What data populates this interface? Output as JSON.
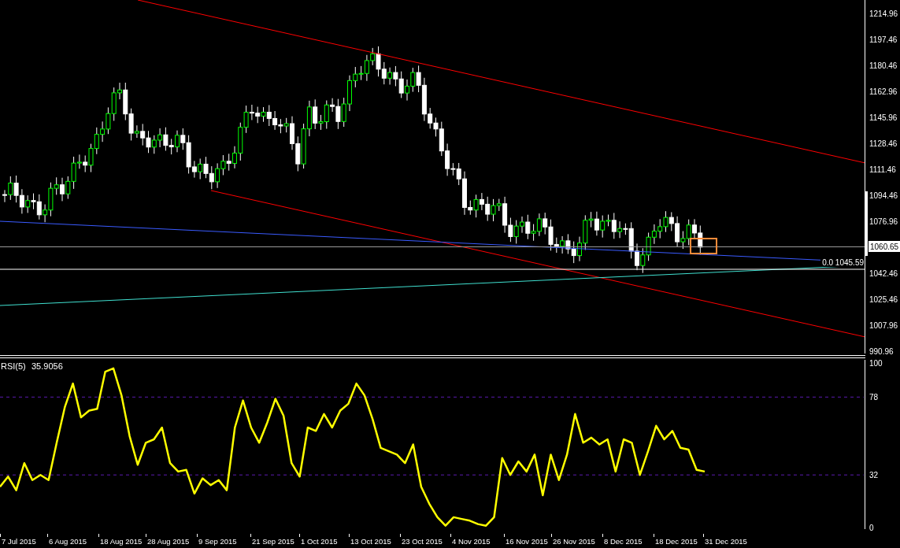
{
  "price_chart": {
    "price_axis": [
      "1214.96",
      "1197.46",
      "1180.46",
      "1162.96",
      "1145.96",
      "1128.46",
      "1111.46",
      "1094.46",
      "1076.96",
      "1042.46",
      "1025.46",
      "1007.96",
      "990.96"
    ],
    "current_price": "1060.65",
    "level_label": "0.0 1045.59"
  },
  "rsi_pane": {
    "reading": "35.9056",
    "chart_data": {
      "type": "line",
      "ylim": [
        0,
        100
      ],
      "yticks": [
        0,
        32,
        78,
        100
      ],
      "series": [
        {
          "name": "RSI(5)",
          "color": "#ffff00",
          "values": [
            25,
            31,
            23,
            39,
            29,
            32,
            29,
            51,
            72,
            86,
            66,
            70,
            71,
            93,
            95,
            79,
            55,
            38,
            51,
            53,
            60,
            39,
            34,
            35,
            21,
            30,
            26,
            29,
            23,
            60,
            76,
            60,
            51,
            63,
            77,
            67,
            39,
            31,
            60,
            58,
            68,
            60,
            70,
            74,
            86,
            79,
            65,
            48,
            46,
            44,
            39,
            50,
            25,
            15,
            7,
            2,
            7,
            6,
            5,
            3,
            2,
            7,
            42,
            32,
            40,
            34,
            44,
            20,
            44,
            29,
            44,
            68,
            51,
            54,
            50,
            53,
            34,
            53,
            51,
            32,
            46,
            61,
            53,
            58,
            48,
            47,
            35,
            34
          ]
        }
      ]
    }
  },
  "date_axis": [
    "7 Jul 2015",
    "6 Aug 2015",
    "18 Aug 2015",
    "28 Aug 2015",
    "9 Sep 2015",
    "21 Sep 2015",
    "1 Oct 2015",
    "13 Oct 2015",
    "23 Oct 2015",
    "4 Nov 2015",
    "16 Nov 2015",
    "26 Nov 2015",
    "8 Dec 2015",
    "18 Dec 2015",
    "31 Dec 2015"
  ]
}
